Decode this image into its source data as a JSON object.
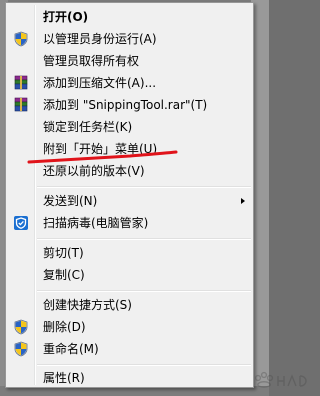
{
  "menu": {
    "items": [
      {
        "label": "打开(O)",
        "icon": "",
        "bold": true,
        "submenu": false
      },
      {
        "label": "以管理员身份运行(A)",
        "icon": "shield-icon",
        "bold": false,
        "submenu": false
      },
      {
        "label": "管理员取得所有权",
        "icon": "",
        "bold": false,
        "submenu": false
      },
      {
        "label": "添加到压缩文件(A)...",
        "icon": "archive-icon",
        "bold": false,
        "submenu": false
      },
      {
        "label": "添加到 \"SnippingTool.rar\"(T)",
        "icon": "archive-icon",
        "bold": false,
        "submenu": false
      },
      {
        "label": "锁定到任务栏(K)",
        "icon": "",
        "bold": false,
        "submenu": false
      },
      {
        "label": "附到「开始」菜单(U)",
        "icon": "",
        "bold": false,
        "submenu": false
      },
      {
        "label": "还原以前的版本(V)",
        "icon": "",
        "bold": false,
        "submenu": false
      },
      {
        "label": "发送到(N)",
        "icon": "",
        "bold": false,
        "submenu": true
      },
      {
        "label": "扫描病毒(电脑管家)",
        "icon": "antivirus-shield-icon",
        "bold": false,
        "submenu": false
      },
      {
        "label": "剪切(T)",
        "icon": "",
        "bold": false,
        "submenu": false
      },
      {
        "label": "复制(C)",
        "icon": "",
        "bold": false,
        "submenu": false
      },
      {
        "label": "创建快捷方式(S)",
        "icon": "",
        "bold": false,
        "submenu": false
      },
      {
        "label": "删除(D)",
        "icon": "shield-icon",
        "bold": false,
        "submenu": false
      },
      {
        "label": "重命名(M)",
        "icon": "shield-icon",
        "bold": false,
        "submenu": false
      },
      {
        "label": "属性(R)",
        "icon": "",
        "bold": false,
        "submenu": false
      }
    ]
  },
  "colors": {
    "menu_bg": "#f0f0f0",
    "annotation_red": "#e0131a",
    "tencent_blue": "#1a6fd1"
  }
}
